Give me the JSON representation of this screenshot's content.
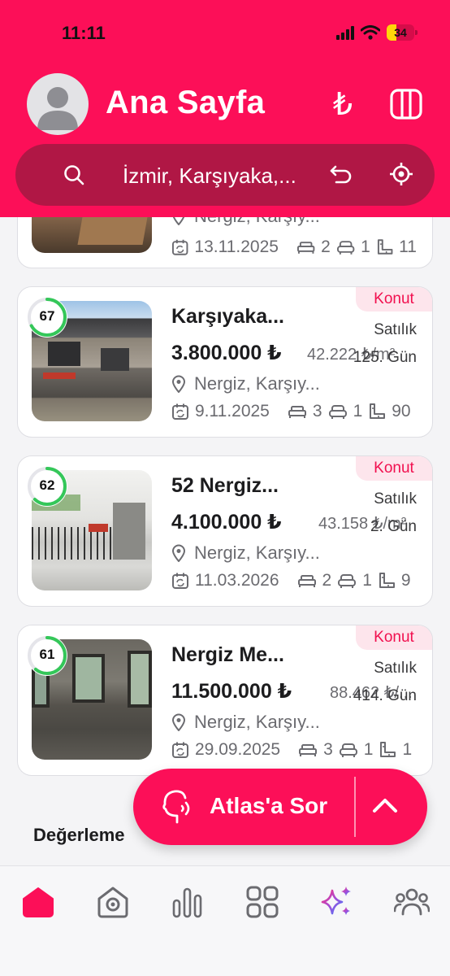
{
  "status_bar": {
    "time": "11:11",
    "battery": "34",
    "battery_level": 0.34
  },
  "header": {
    "title": "Ana Sayfa",
    "search_text": "İzmir, Karşıyaka,...",
    "currency_symbol": "₺"
  },
  "colors": {
    "brand": "#fc0f58",
    "search_bg": "#b01745",
    "badge_bg": "#fde5ec",
    "score_ring": "#34c759"
  },
  "listings": [
    {
      "title": "",
      "location": "Nergiz, Karşıy...",
      "date": "13.11.2025",
      "rooms": "2",
      "salons": "1",
      "area": "11"
    },
    {
      "score": "67",
      "score_value": 67,
      "badge": "Konut",
      "title": "Karşıyaka...",
      "type": "Satılık",
      "price": "3.800.000 ₺",
      "sqm_price": "42.222 ₺/m²",
      "days": "125. Gün",
      "location": "Nergiz, Karşıy...",
      "date": "9.11.2025",
      "rooms": "3",
      "salons": "1",
      "area": "90"
    },
    {
      "score": "62",
      "score_value": 62,
      "badge": "Konut",
      "title": "52 Nergiz...",
      "type": "Satılık",
      "price": "4.100.000 ₺",
      "sqm_price": "43.158 ₺/m²",
      "days": "2. Gün",
      "location": "Nergiz, Karşıy...",
      "date": "11.03.2026",
      "rooms": "2",
      "salons": "1",
      "area": "9"
    },
    {
      "score": "61",
      "score_value": 61,
      "badge": "Konut",
      "title": "Nergiz Me...",
      "type": "Satılık",
      "price": "11.500.000 ₺",
      "sqm_price": "88.462 ₺/...",
      "days": "414. Gün",
      "location": "Nergiz, Karşıy...",
      "date": "29.09.2025",
      "rooms": "3",
      "salons": "1",
      "area": "1"
    }
  ],
  "ask_button": {
    "label": "Atlas'a Sor"
  },
  "section": {
    "title": "Değerleme"
  },
  "tabs": [
    {
      "icon": "home-icon",
      "active": true
    },
    {
      "icon": "location-house-icon"
    },
    {
      "icon": "bar-chart-icon"
    },
    {
      "icon": "grid-icon"
    },
    {
      "icon": "sparkles-icon"
    },
    {
      "icon": "users-icon"
    }
  ]
}
